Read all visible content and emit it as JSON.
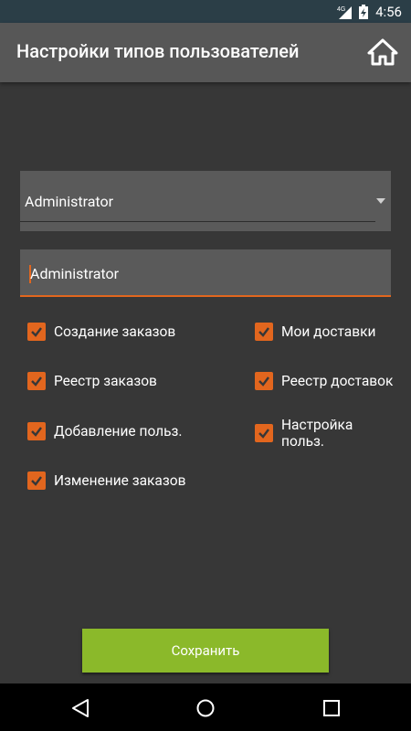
{
  "status_bar": {
    "network": "4G",
    "time": "4:56"
  },
  "app_bar": {
    "title": "Настройки типов пользователей",
    "home_icon": "home-icon"
  },
  "form": {
    "user_type_select": {
      "value": "Administrator"
    },
    "name_field": {
      "value": "Administrator"
    }
  },
  "permissions": [
    {
      "label": "Создание заказов",
      "checked": true
    },
    {
      "label": "Мои доставки",
      "checked": true
    },
    {
      "label": "Реестр заказов",
      "checked": true
    },
    {
      "label": "Реестр доставок",
      "checked": true
    },
    {
      "label": "Добавление польз.",
      "checked": true
    },
    {
      "label": "Настройка польз.",
      "checked": true
    },
    {
      "label": "Изменение заказов",
      "checked": true
    }
  ],
  "actions": {
    "save_label": "Сохранить"
  },
  "colors": {
    "accent": "#e2661e",
    "save_button": "#8bb92a",
    "background": "#373737",
    "app_bar": "#575757"
  }
}
